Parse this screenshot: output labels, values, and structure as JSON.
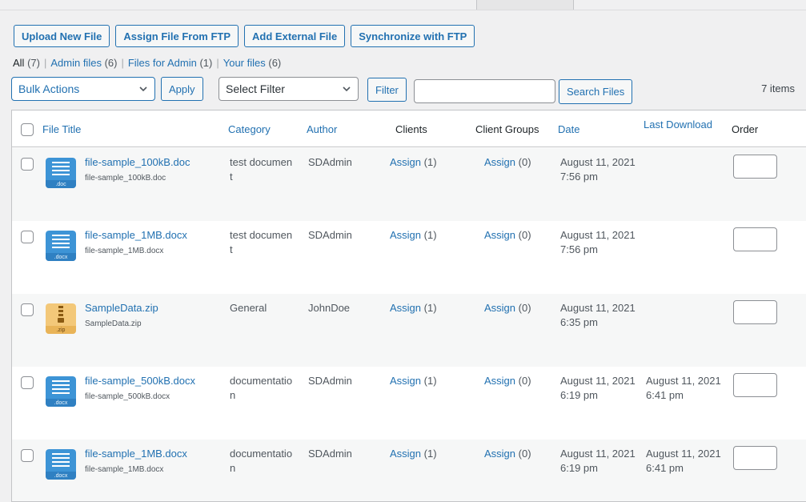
{
  "toolbar": {
    "upload": "Upload New File",
    "assign_ftp": "Assign File From FTP",
    "add_external": "Add External File",
    "sync_ftp": "Synchronize with FTP"
  },
  "views": [
    {
      "label": "All",
      "count": "(7)"
    },
    {
      "label": "Admin files",
      "count": "(6)"
    },
    {
      "label": "Files for Admin",
      "count": "(1)"
    },
    {
      "label": "Your files",
      "count": "(6)"
    }
  ],
  "bulk": {
    "selected": "Bulk Actions",
    "apply": "Apply"
  },
  "filter": {
    "selected": "Select Filter",
    "button": "Filter"
  },
  "search": {
    "placeholder": "",
    "button": "Search Files"
  },
  "items_count": "7 items",
  "columns": {
    "title": "File Title",
    "category": "Category",
    "author": "Author",
    "clients": "Clients",
    "groups": "Client Groups",
    "date": "Date",
    "last_download": "Last Download",
    "order": "Order"
  },
  "rows": [
    {
      "title": "file-sample_100kB.doc",
      "filename": "file-sample_100kB.doc",
      "ext": ".doc",
      "icon": "document-icon",
      "category": "test document",
      "author": "SDAdmin",
      "clients": "Assign",
      "clients_count": "(1)",
      "groups": "Assign",
      "groups_count": "(0)",
      "date": "August 11, 2021",
      "time": "7:56 pm",
      "ld_date": "",
      "ld_time": ""
    },
    {
      "title": "file-sample_1MB.docx",
      "filename": "file-sample_1MB.docx",
      "ext": ".docx",
      "icon": "document-icon",
      "category": "test document",
      "author": "SDAdmin",
      "clients": "Assign",
      "clients_count": "(1)",
      "groups": "Assign",
      "groups_count": "(0)",
      "date": "August 11, 2021",
      "time": "7:56 pm",
      "ld_date": "",
      "ld_time": ""
    },
    {
      "title": "SampleData.zip",
      "filename": "SampleData.zip",
      "ext": ".zip",
      "icon": "zip-archive-icon",
      "category": "General",
      "author": "JohnDoe",
      "clients": "Assign",
      "clients_count": "(1)",
      "groups": "Assign",
      "groups_count": "(0)",
      "date": "August 11, 2021",
      "time": "6:35 pm",
      "ld_date": "",
      "ld_time": ""
    },
    {
      "title": "file-sample_500kB.docx",
      "filename": "file-sample_500kB.docx",
      "ext": ".docx",
      "icon": "document-icon",
      "category": "documentation",
      "author": "SDAdmin",
      "clients": "Assign",
      "clients_count": "(1)",
      "groups": "Assign",
      "groups_count": "(0)",
      "date": "August 11, 2021",
      "time": "6:19 pm",
      "ld_date": "August 11, 2021",
      "ld_time": "6:41 pm"
    },
    {
      "title": "file-sample_1MB.docx",
      "filename": "file-sample_1MB.docx",
      "ext": ".docx",
      "icon": "document-icon",
      "category": "documentation",
      "author": "SDAdmin",
      "clients": "Assign",
      "clients_count": "(1)",
      "groups": "Assign",
      "groups_count": "(0)",
      "date": "August 11, 2021",
      "time": "6:19 pm",
      "ld_date": "August 11, 2021",
      "ld_time": "6:41 pm"
    }
  ],
  "colors": {
    "accent": "#2271b1",
    "doc_icon": "#3d94d6",
    "zip_icon": "#f0c46a"
  }
}
